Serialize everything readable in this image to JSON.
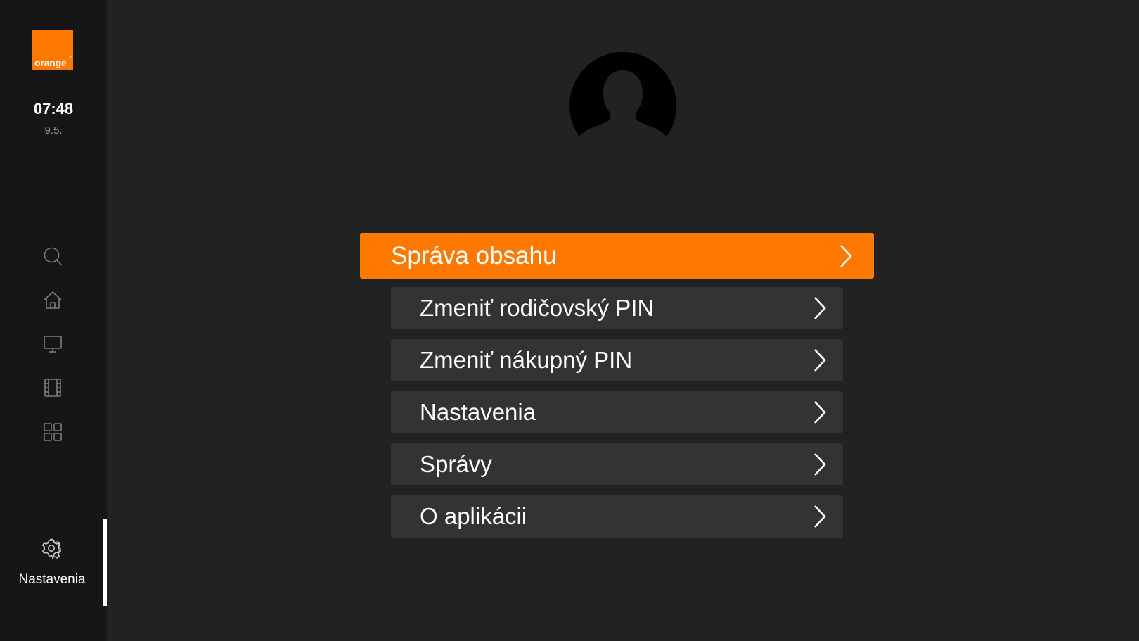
{
  "brand": {
    "logo_text": "orange",
    "logo_tm": "™",
    "accent_color": "#ff7900"
  },
  "sidebar": {
    "time": "07:48",
    "date": "9.5.",
    "nav_icons": [
      "search-icon",
      "home-icon",
      "tv-icon",
      "film-icon",
      "apps-grid-icon"
    ],
    "active_item": {
      "icon": "gear-icon",
      "label": "Nastavenia"
    }
  },
  "profile": {
    "avatar": "user-silhouette-icon"
  },
  "menu": {
    "items": [
      {
        "label": "Správa obsahu",
        "focused": true
      },
      {
        "label": "Zmeniť rodičovský PIN",
        "focused": false
      },
      {
        "label": "Zmeniť nákupný PIN",
        "focused": false
      },
      {
        "label": "Nastavenia",
        "focused": false
      },
      {
        "label": "Správy",
        "focused": false
      },
      {
        "label": "O aplikácii",
        "focused": false
      }
    ]
  }
}
